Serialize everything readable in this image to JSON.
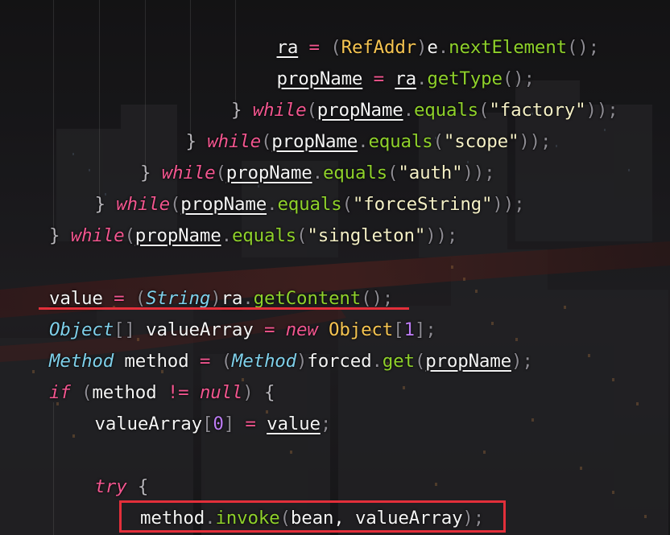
{
  "colors": {
    "keyword": "#f2568f",
    "type": "#f5c451",
    "italic_type": "#7fd0ea",
    "method": "#8fd12b",
    "string": "#f5f0c6",
    "number": "#bd7cf5",
    "identifier": "#f4f4f4",
    "highlight": "#e32f3a"
  },
  "code_lines": [
    {
      "indent": 6,
      "tokens": [
        {
          "t": "ra",
          "c": "var"
        },
        {
          "t": " = ",
          "c": "op"
        },
        {
          "t": "(",
          "c": "paren"
        },
        {
          "t": "RefAddr",
          "c": "type"
        },
        {
          "t": ")",
          "c": "paren"
        },
        {
          "t": "e",
          "c": "id"
        },
        {
          "t": ".",
          "c": "punct"
        },
        {
          "t": "nextElement",
          "c": "fn"
        },
        {
          "t": "();",
          "c": "paren"
        }
      ]
    },
    {
      "indent": 6,
      "tokens": [
        {
          "t": "propName",
          "c": "var"
        },
        {
          "t": " = ",
          "c": "op"
        },
        {
          "t": "ra",
          "c": "var"
        },
        {
          "t": ".",
          "c": "punct"
        },
        {
          "t": "getType",
          "c": "fn"
        },
        {
          "t": "();",
          "c": "paren"
        }
      ]
    },
    {
      "indent": 5,
      "tokens": [
        {
          "t": "} ",
          "c": "brace"
        },
        {
          "t": "while",
          "c": "kw"
        },
        {
          "t": "(",
          "c": "paren"
        },
        {
          "t": "propName",
          "c": "var"
        },
        {
          "t": ".",
          "c": "punct"
        },
        {
          "t": "equals",
          "c": "fn"
        },
        {
          "t": "(",
          "c": "paren"
        },
        {
          "t": "\"factory\"",
          "c": "str"
        },
        {
          "t": "));",
          "c": "paren"
        }
      ]
    },
    {
      "indent": 4,
      "tokens": [
        {
          "t": "} ",
          "c": "brace"
        },
        {
          "t": "while",
          "c": "kw"
        },
        {
          "t": "(",
          "c": "paren"
        },
        {
          "t": "propName",
          "c": "var"
        },
        {
          "t": ".",
          "c": "punct"
        },
        {
          "t": "equals",
          "c": "fn"
        },
        {
          "t": "(",
          "c": "paren"
        },
        {
          "t": "\"scope\"",
          "c": "str"
        },
        {
          "t": "));",
          "c": "paren"
        }
      ]
    },
    {
      "indent": 3,
      "tokens": [
        {
          "t": "} ",
          "c": "brace"
        },
        {
          "t": "while",
          "c": "kw"
        },
        {
          "t": "(",
          "c": "paren"
        },
        {
          "t": "propName",
          "c": "var"
        },
        {
          "t": ".",
          "c": "punct"
        },
        {
          "t": "equals",
          "c": "fn"
        },
        {
          "t": "(",
          "c": "paren"
        },
        {
          "t": "\"auth\"",
          "c": "str"
        },
        {
          "t": "));",
          "c": "paren"
        }
      ]
    },
    {
      "indent": 2,
      "tokens": [
        {
          "t": "} ",
          "c": "brace"
        },
        {
          "t": "while",
          "c": "kw"
        },
        {
          "t": "(",
          "c": "paren"
        },
        {
          "t": "propName",
          "c": "var"
        },
        {
          "t": ".",
          "c": "punct"
        },
        {
          "t": "equals",
          "c": "fn"
        },
        {
          "t": "(",
          "c": "paren"
        },
        {
          "t": "\"forceString\"",
          "c": "str"
        },
        {
          "t": "));",
          "c": "paren"
        }
      ]
    },
    {
      "indent": 1,
      "tokens": [
        {
          "t": "} ",
          "c": "brace"
        },
        {
          "t": "while",
          "c": "kw"
        },
        {
          "t": "(",
          "c": "paren"
        },
        {
          "t": "propName",
          "c": "var"
        },
        {
          "t": ".",
          "c": "punct"
        },
        {
          "t": "equals",
          "c": "fn"
        },
        {
          "t": "(",
          "c": "paren"
        },
        {
          "t": "\"singleton\"",
          "c": "str"
        },
        {
          "t": "));",
          "c": "paren"
        }
      ]
    },
    {
      "indent": 1,
      "tokens": []
    },
    {
      "indent": 1,
      "tokens": [
        {
          "t": "value",
          "c": "var"
        },
        {
          "t": " = ",
          "c": "op"
        },
        {
          "t": "(",
          "c": "paren"
        },
        {
          "t": "String",
          "c": "itype"
        },
        {
          "t": ")",
          "c": "paren"
        },
        {
          "t": "ra",
          "c": "var"
        },
        {
          "t": ".",
          "c": "punct"
        },
        {
          "t": "getContent",
          "c": "fn"
        },
        {
          "t": "();",
          "c": "paren"
        }
      ]
    },
    {
      "indent": 1,
      "tokens": [
        {
          "t": "Object",
          "c": "itype"
        },
        {
          "t": "[]",
          "c": "paren"
        },
        {
          "t": " valueArray",
          "c": "id"
        },
        {
          "t": " = ",
          "c": "op"
        },
        {
          "t": "new",
          "c": "kw"
        },
        {
          "t": " ",
          "c": "id"
        },
        {
          "t": "Object",
          "c": "type"
        },
        {
          "t": "[",
          "c": "paren"
        },
        {
          "t": "1",
          "c": "num"
        },
        {
          "t": "];",
          "c": "paren"
        }
      ]
    },
    {
      "indent": 1,
      "tokens": [
        {
          "t": "Method",
          "c": "itype"
        },
        {
          "t": " method",
          "c": "id"
        },
        {
          "t": " = ",
          "c": "op"
        },
        {
          "t": "(",
          "c": "paren"
        },
        {
          "t": "Method",
          "c": "itype"
        },
        {
          "t": ")",
          "c": "paren"
        },
        {
          "t": "forced",
          "c": "id"
        },
        {
          "t": ".",
          "c": "punct"
        },
        {
          "t": "get",
          "c": "fn"
        },
        {
          "t": "(",
          "c": "paren"
        },
        {
          "t": "propName",
          "c": "var"
        },
        {
          "t": ");",
          "c": "paren"
        }
      ]
    },
    {
      "indent": 1,
      "tokens": [
        {
          "t": "if",
          "c": "kw"
        },
        {
          "t": " (",
          "c": "paren"
        },
        {
          "t": "method",
          "c": "id"
        },
        {
          "t": " != ",
          "c": "op"
        },
        {
          "t": "null",
          "c": "kw"
        },
        {
          "t": ") ",
          "c": "paren"
        },
        {
          "t": "{",
          "c": "brace"
        }
      ]
    },
    {
      "indent": 2,
      "tokens": [
        {
          "t": "valueArray",
          "c": "id"
        },
        {
          "t": "[",
          "c": "paren"
        },
        {
          "t": "0",
          "c": "num"
        },
        {
          "t": "]",
          "c": "paren"
        },
        {
          "t": " = ",
          "c": "op"
        },
        {
          "t": "value",
          "c": "var"
        },
        {
          "t": ";",
          "c": "paren"
        }
      ]
    },
    {
      "indent": 2,
      "tokens": []
    },
    {
      "indent": 2,
      "tokens": [
        {
          "t": "try",
          "c": "kw"
        },
        {
          "t": " {",
          "c": "brace"
        }
      ]
    },
    {
      "indent": 3,
      "tokens": [
        {
          "t": "method",
          "c": "id"
        },
        {
          "t": ".",
          "c": "punct"
        },
        {
          "t": "invoke",
          "c": "fn"
        },
        {
          "t": "(",
          "c": "paren"
        },
        {
          "t": "bean, valueArray",
          "c": "id"
        },
        {
          "t": ");",
          "c": "paren"
        }
      ]
    }
  ]
}
